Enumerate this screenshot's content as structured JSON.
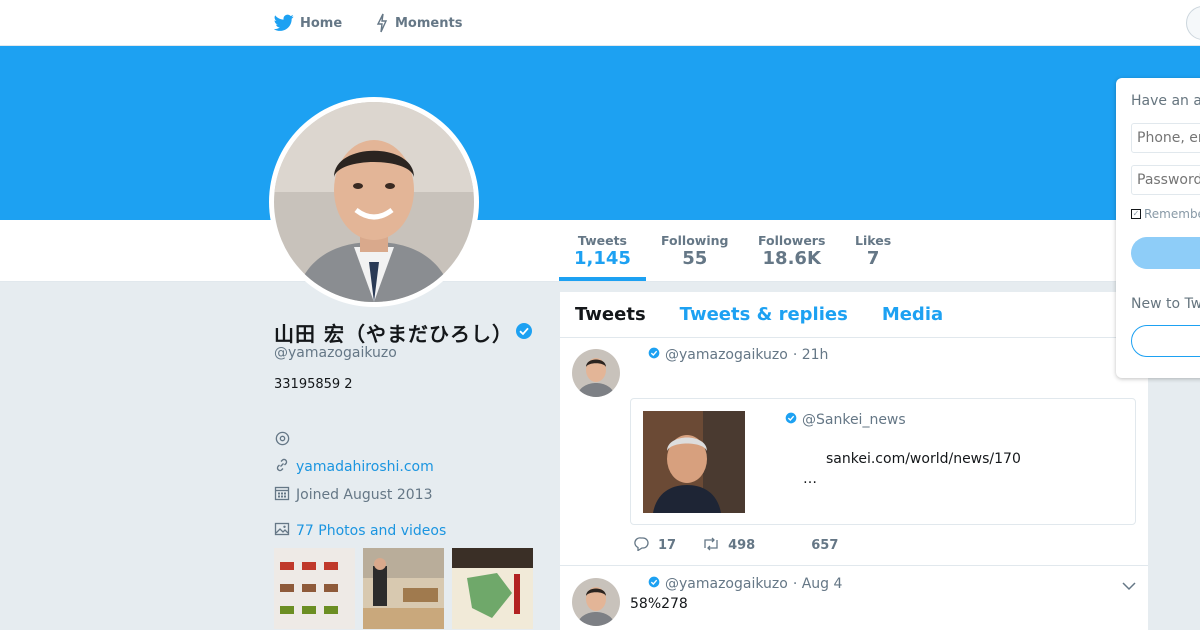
{
  "nav": {
    "home_label": "Home",
    "moments_label": "Moments"
  },
  "colors": {
    "brand_blue": "#1da1f2",
    "link_blue": "#1b95e0",
    "secondary_text": "#657786",
    "page_background": "#e6ecf0"
  },
  "profile": {
    "fullname": "山田 宏（やまだひろし）",
    "screen_name": "@yamazogaikuzo",
    "bio": "33195859 2",
    "url": "yamadahiroshi.com",
    "joined": "Joined August 2013",
    "photos_label": "77 Photos and videos"
  },
  "stats": [
    {
      "label": "Tweets",
      "value": "1,145"
    },
    {
      "label": "Following",
      "value": "55"
    },
    {
      "label": "Followers",
      "value": "18.6K"
    },
    {
      "label": "Likes",
      "value": "7"
    }
  ],
  "tabs": [
    {
      "label": "Tweets"
    },
    {
      "label": "Tweets & replies"
    },
    {
      "label": "Media"
    }
  ],
  "tweets": [
    {
      "handle": "@yamazogaikuzo",
      "time": "· 21h",
      "quote": {
        "handle": "@Sankei_news",
        "link": "sankei.com/world/news/170",
        "ellipsis": "…"
      },
      "replies": "17",
      "retweets": "498",
      "likes": "657"
    },
    {
      "handle": "@yamazogaikuzo",
      "time": "· Aug 4",
      "text": "58%278"
    }
  ],
  "login": {
    "title": "Have an account?",
    "phone_placeholder": "Phone, email or username",
    "password_placeholder": "Password",
    "remember_label": "Remember me",
    "new_to": "New to Twitter?"
  },
  "icons": {
    "home": "bird-icon",
    "moments": "lightning-icon",
    "location": "location-pin-icon",
    "url": "link-icon",
    "joined": "calendar-icon",
    "photos": "photo-icon",
    "verified": "verified-badge-icon"
  }
}
